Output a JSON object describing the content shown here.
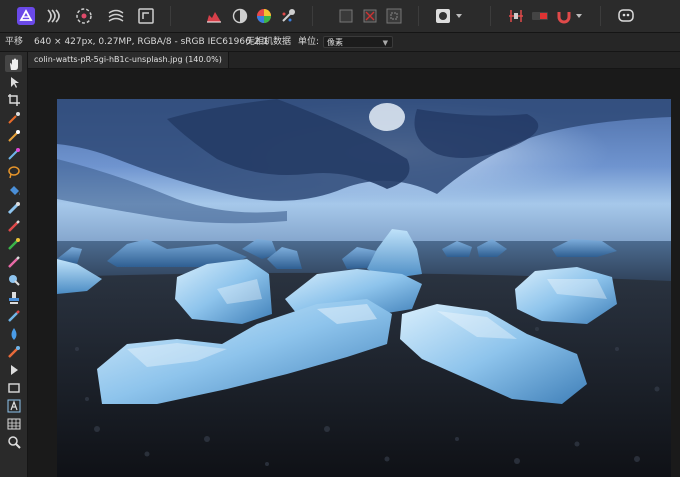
{
  "toolbar": {
    "left_tools": [
      "persona-photo-icon",
      "liquify-persona-icon",
      "develop-persona-icon",
      "tone-mapping-persona-icon",
      "export-persona-icon"
    ],
    "middle_tools": [
      "histogram-icon",
      "auto-contrast-icon",
      "auto-color-icon",
      "auto-white-balance-icon"
    ],
    "selection_tools": [
      "marquee-select-icon",
      "deselect-icon",
      "invert-selection-icon"
    ],
    "right_tools": [
      "quick-mask-icon",
      "snapping-icon",
      "magnet-icon",
      "assistant-icon"
    ]
  },
  "context": {
    "tool_name": "平移",
    "doc_info": "640 × 427px, 0.27MP, RGBA/8 - sRGB IEC61966-2.1",
    "camera": "无相机数据",
    "unit_label": "单位:",
    "unit_value": "像素"
  },
  "document": {
    "tab_title": "colin-watts-pR-5gi-hB1c-unsplash.jpg (140.0%)"
  },
  "tools": [
    "hand-icon",
    "move-icon",
    "crop-icon",
    "color-picker-icon",
    "magic-wand-icon",
    "lasso-icon",
    "flood-fill-icon",
    "paint-brush-icon",
    "pencil-icon",
    "healing-brush-icon",
    "erase-brush-icon",
    "dodge-icon",
    "burn-icon",
    "blur-brush-icon",
    "sharpen-icon",
    "clone-icon",
    "node-icon",
    "rectangle-icon",
    "text-icon",
    "table-icon",
    "zoom-icon"
  ],
  "colors": {
    "accent": "#5a3fd6",
    "panel": "#2b2b2b",
    "canvas": "#1a1a1a",
    "active_tool": "#454545"
  }
}
